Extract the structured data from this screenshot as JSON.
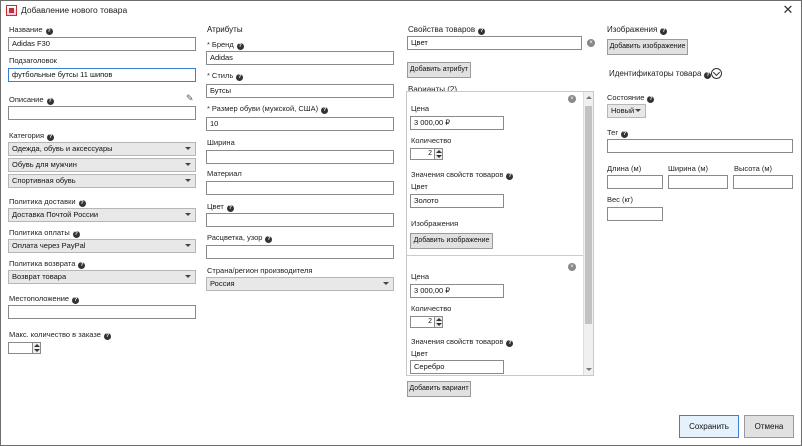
{
  "window": {
    "title": "Добавление нового товара",
    "close": "✕"
  },
  "col1": {
    "name_label": "Название",
    "name_value": "Adidas F30",
    "subtitle_label": "Подзаголовок",
    "subtitle_value": "футбольные бутсы 11 шипов",
    "description_label": "Описание",
    "description_value": "",
    "category_label": "Категория",
    "category_values": [
      "Одежда, обувь и аксессуары",
      "Обувь для мужчин",
      "Спортивная обувь"
    ],
    "shipping_label": "Политика доставки",
    "shipping_value": "Доставка Почтой России",
    "payment_label": "Политика оплаты",
    "payment_value": "Оплата через PayPal",
    "return_label": "Политика возврата",
    "return_value": "Возврат товара",
    "location_label": "Местоположение",
    "location_value": "",
    "max_qty_label": "Макс. количество в заказе",
    "max_qty_value": ""
  },
  "col2": {
    "attributes_label": "Атрибуты",
    "brand_label": "Бренд",
    "brand_value": "Adidas",
    "style_label": "Стиль",
    "style_value": "Бутсы",
    "size_label": "Размер обуви (мужской, США)",
    "size_value": "10",
    "width_label": "Ширина",
    "width_value": "",
    "material_label": "Материал",
    "material_value": "",
    "color_label": "Цвет",
    "color_value": "",
    "pattern_label": "Расцветка, узор",
    "pattern_value": "",
    "country_label": "Страна/регион производителя",
    "country_value": "Россия",
    "required_mark": "*"
  },
  "col3": {
    "props_label": "Свойства товаров",
    "props_value": "Цвет",
    "add_attr_button": "Добавить атрибут",
    "variants_label": "Варианты (2)",
    "variants": [
      {
        "price_label": "Цена",
        "price_value": "3 000,00 ₽",
        "qty_label": "Количество",
        "qty_value": "2",
        "prop_values_label": "Значения свойств товаров",
        "prop_name": "Цвет",
        "prop_value": "Золото",
        "images_label": "Изображения",
        "add_image_button": "Добавить изображение"
      },
      {
        "price_label": "Цена",
        "price_value": "3 000,00 ₽",
        "qty_label": "Количество",
        "qty_value": "2",
        "prop_values_label": "Значения свойств товаров",
        "prop_name": "Цвет",
        "prop_value": "Серебро"
      }
    ],
    "add_variant_button": "Добавить вариант"
  },
  "col4": {
    "images_label": "Изображения",
    "add_image_button": "Добавить изображение",
    "identifiers_label": "Идентификаторы товара",
    "condition_label": "Состояние",
    "condition_value": "Новый",
    "tag_label": "Тег",
    "tag_value": "",
    "length_label": "Длина (м)",
    "width_label": "Ширина (м)",
    "height_label": "Высота (м)",
    "weight_label": "Вес (кг)"
  },
  "footer": {
    "save_button": "Сохранить",
    "cancel_button": "Отмена"
  }
}
